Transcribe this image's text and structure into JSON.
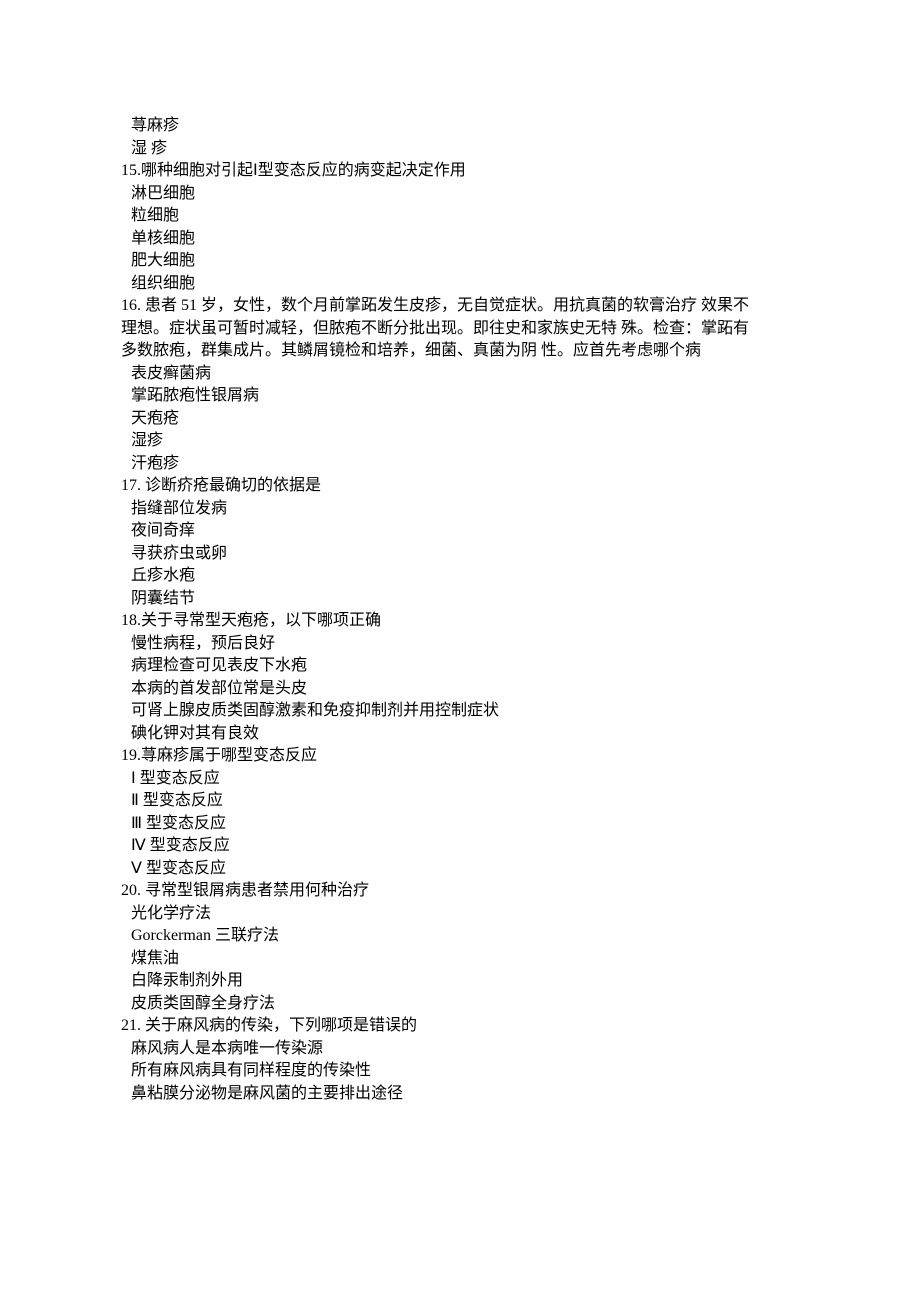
{
  "lines": [
    {
      "cls": "line opt",
      "text": "荨麻疹"
    },
    {
      "cls": "line opt",
      "text": "湿 疹"
    },
    {
      "cls": "line q",
      "text": "15.哪种细胞对引起Ⅰ型变态反应的病变起决定作用"
    },
    {
      "cls": "line opt",
      "text": "淋巴细胞"
    },
    {
      "cls": "line opt",
      "text": "粒细胞"
    },
    {
      "cls": "line opt",
      "text": "单核细胞"
    },
    {
      "cls": "line opt",
      "text": "肥大细胞"
    },
    {
      "cls": "line opt",
      "text": "组织细胞"
    },
    {
      "cls": "line q",
      "text": "16. 患者 51 岁，女性，数个月前掌跖发生皮疹，无自觉症状。用抗真菌的软膏治疗 效果不"
    },
    {
      "cls": "line cont",
      "text": "理想。症状虽可暂时减轻，但脓疱不断分批出现。即往史和家族史无特 殊。检查：掌跖有"
    },
    {
      "cls": "line cont",
      "text": "多数脓疱，群集成片。其鳞屑镜检和培养，细菌、真菌为阴 性。应首先考虑哪个病"
    },
    {
      "cls": "line opt",
      "text": "表皮癣菌病"
    },
    {
      "cls": "line opt",
      "text": "掌跖脓疱性银屑病"
    },
    {
      "cls": "line opt",
      "text": "天疱疮"
    },
    {
      "cls": "line opt",
      "text": "湿疹"
    },
    {
      "cls": "line opt",
      "text": "汗疱疹"
    },
    {
      "cls": "line q",
      "text": "17. 诊断疥疮最确切的依据是"
    },
    {
      "cls": "line opt",
      "text": "指缝部位发病"
    },
    {
      "cls": "line opt",
      "text": "夜间奇痒"
    },
    {
      "cls": "line opt",
      "text": "寻获疥虫或卵"
    },
    {
      "cls": "line opt",
      "text": "丘疹水疱"
    },
    {
      "cls": "line opt",
      "text": "阴囊结节"
    },
    {
      "cls": "line q",
      "text": "18.关于寻常型天疱疮，以下哪项正确"
    },
    {
      "cls": "line opt",
      "text": "慢性病程，预后良好"
    },
    {
      "cls": "line opt",
      "text": "病理检查可见表皮下水疱"
    },
    {
      "cls": "line opt",
      "text": "本病的首发部位常是头皮"
    },
    {
      "cls": "line opt",
      "text": "可肾上腺皮质类固醇激素和免疫抑制剂并用控制症状"
    },
    {
      "cls": "line opt",
      "text": "碘化钾对其有良效"
    },
    {
      "cls": "line q",
      "text": "19.荨麻疹属于哪型变态反应"
    },
    {
      "cls": "line opt",
      "text": "Ⅰ 型变态反应"
    },
    {
      "cls": "line opt",
      "text": "Ⅱ 型变态反应"
    },
    {
      "cls": "line opt",
      "text": "Ⅲ 型变态反应"
    },
    {
      "cls": "line opt",
      "text": "Ⅳ 型变态反应"
    },
    {
      "cls": "line opt",
      "text": "Ⅴ 型变态反应"
    },
    {
      "cls": "line q",
      "text": "20. 寻常型银屑病患者禁用何种治疗"
    },
    {
      "cls": "line opt",
      "text": "光化学疗法"
    },
    {
      "cls": "line opt",
      "latin": "Gorckerman ",
      "text": "三联疗法"
    },
    {
      "cls": "line opt",
      "text": "煤焦油"
    },
    {
      "cls": "line opt",
      "text": "白降汞制剂外用"
    },
    {
      "cls": "line opt",
      "text": "皮质类固醇全身疗法"
    },
    {
      "cls": "line q",
      "text": "21. 关于麻风病的传染，下列哪项是错误的"
    },
    {
      "cls": "line opt",
      "text": "麻风病人是本病唯一传染源"
    },
    {
      "cls": "line opt",
      "text": "所有麻风病具有同样程度的传染性"
    },
    {
      "cls": "line opt",
      "text": "鼻粘膜分泌物是麻风菌的主要排出途径"
    }
  ]
}
